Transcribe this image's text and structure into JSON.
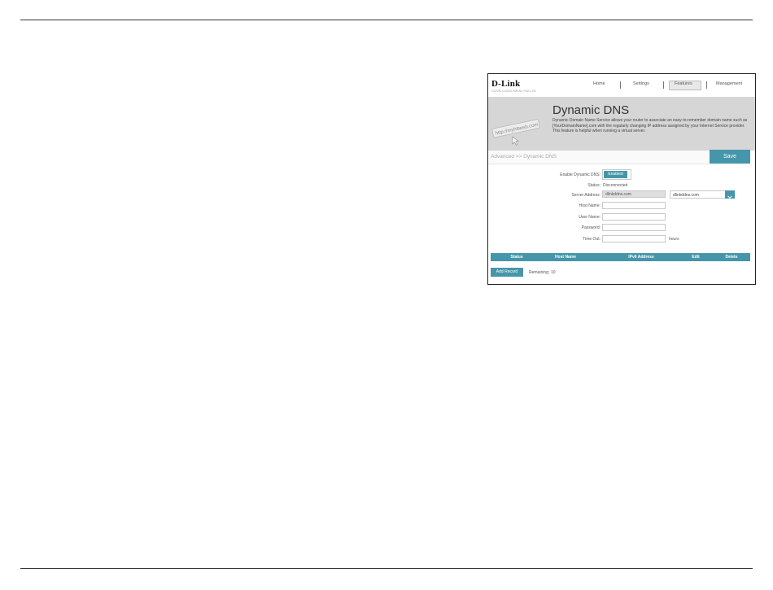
{
  "brand": {
    "logo": "D-Link",
    "model": "COVR-C1203 HW:A1 FW:1.00"
  },
  "nav": {
    "home": "Home",
    "settings": "Settings",
    "features": "Features",
    "management": "Management"
  },
  "banner": {
    "title": "Dynamic DNS",
    "description": "Dynamic Domain Name Service allows your router to associate an easy-to-remember domain name such as [YourDomainName].com with the regularly changing IP address assigned by your Internet Service provider. This feature is helpful when running a virtual server.",
    "graphic_text": "http://myhttweb.com"
  },
  "breadcrumb": "Advanced >> Dynamic DNS",
  "save_label": "Save",
  "form": {
    "enable_label": "Enable Dynamic DNS:",
    "enable_value": "Enabled",
    "status_label": "Status:",
    "status_value": "Disconnected",
    "server_label": "Server Address:",
    "server_value": "dlinkddns.com",
    "server_select": "dlinkddns.com",
    "host_label": "Host Name:",
    "user_label": "User Name:",
    "password_label": "Password:",
    "timeout_label": "Time Out:",
    "timeout_unit": "hours"
  },
  "table": {
    "headers": [
      "Status",
      "Host Name",
      "IPv6 Address",
      "Edit",
      "Delete"
    ]
  },
  "add_record_label": "Add Record",
  "remaining_label": "Remaining:",
  "remaining_value": "10",
  "colors": {
    "accent": "#4596ab",
    "banner": "#d6d6d6"
  }
}
